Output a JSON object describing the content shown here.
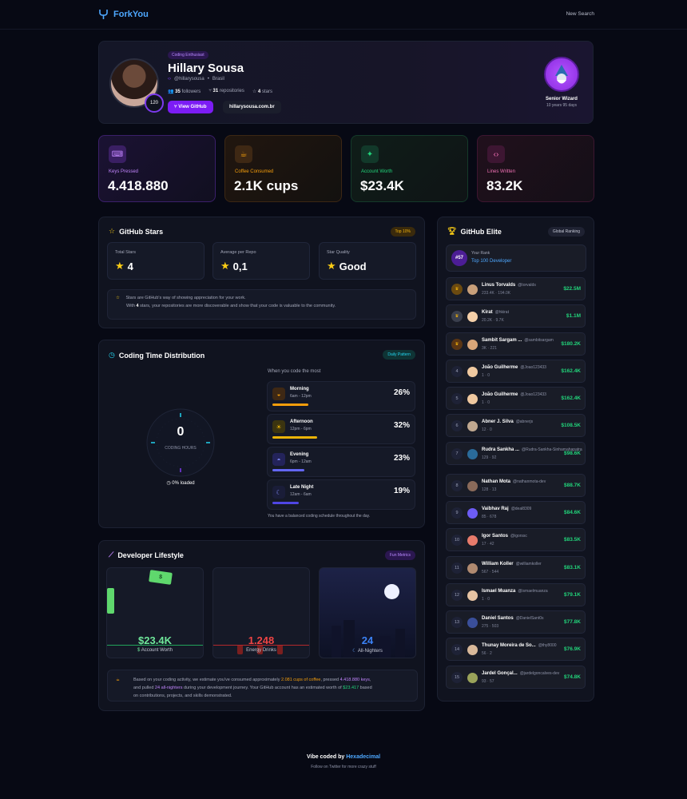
{
  "nav": {
    "brand": "ForkYou",
    "new_search": "New Search"
  },
  "profile": {
    "badge": "Coding Enthusiast",
    "name": "Hillary Sousa",
    "handle": "@hillarysousa",
    "location": "Brasil",
    "followers": "35",
    "followers_label": "followers",
    "repos": "31",
    "repos_label": "repositories",
    "stars": "4",
    "stars_label": "stars",
    "level": "120",
    "view_github": "View GitHub",
    "website": "hillarysousa.com.br",
    "rank_title": "Senior Wizard",
    "rank_sub": "10 years 95 days"
  },
  "stats": [
    {
      "label": "Keys Pressed",
      "value": "4.418.880",
      "color": "#c084fc"
    },
    {
      "label": "Coffee Consumed",
      "value": "2.1K cups",
      "color": "#f59e0b"
    },
    {
      "label": "Account Worth",
      "value": "$23.4K",
      "color": "#22d37a"
    },
    {
      "label": "Lines Written",
      "value": "83.2K",
      "color": "#f472b6"
    }
  ],
  "stars_section": {
    "title": "GitHub Stars",
    "badge": "Top 10%",
    "total_label": "Total Stars",
    "total": "4",
    "avg_label": "Average per Repo",
    "avg": "0,1",
    "quality_label": "Star Quality",
    "quality": "Good",
    "note_line1": "Stars are GitHub's way of showing appreciation for your work.",
    "note_line2_a": "With ",
    "note_line2_b": "4",
    "note_line2_c": " stars, your repositories are more discoverable and show that your code is valuable to the community."
  },
  "coding_time": {
    "title": "Coding Time Distribution",
    "badge": "Daily Pattern",
    "clock_value": "0",
    "clock_label": "CODING HOURS",
    "loaded": "0% loaded",
    "subtitle": "When you code the most",
    "slots": [
      {
        "name": "Morning",
        "range": "6am - 12pm",
        "pct": "26%",
        "fraction": 0.26,
        "color": "#f59e0b"
      },
      {
        "name": "Afternoon",
        "range": "12pm - 6pm",
        "pct": "32%",
        "fraction": 0.32,
        "color": "#eab308"
      },
      {
        "name": "Evening",
        "range": "6pm - 12am",
        "pct": "23%",
        "fraction": 0.23,
        "color": "#6366f1"
      },
      {
        "name": "Late Night",
        "range": "12am - 6am",
        "pct": "19%",
        "fraction": 0.19,
        "color": "#4f46e5"
      }
    ],
    "footer": "You have a balanced coding schedule throughout the day."
  },
  "lifestyle": {
    "title": "Developer Lifestyle",
    "badge": "Fun Metrics",
    "cards": [
      {
        "value": "$23.4K",
        "label": "Account Worth",
        "color": "#6ee79a"
      },
      {
        "value": "1.248",
        "label": "Energy Drinks",
        "color": "#ef4444"
      },
      {
        "value": "24",
        "label": "All-Nighters",
        "color": "#3b82f6"
      }
    ],
    "note_a": "Based on your coding activity, we estimate you've consumed approximately ",
    "note_coffee": "2.081 cups of coffee",
    "note_b": ", pressed ",
    "note_keys": "4.418.880 keys",
    "note_c": ",",
    "note_d": "and pulled ",
    "note_night": "24 all-nighters",
    "note_e": " during your development journey. Your GitHub account has an estimated worth of ",
    "note_worth": "$23.417",
    "note_f": " based",
    "note_g": "on contributions, projects, and skills demonstrated."
  },
  "elite": {
    "title": "GitHub Elite",
    "badge": "Global Ranking",
    "your_rank_label": "Your Rank",
    "your_rank": "#57",
    "your_rank_desc": "Top 100 Developer",
    "rows": [
      {
        "rank": "",
        "name": "Linus Torvalds",
        "handle": "@torvalds",
        "stats": "233.4K · 194.0K",
        "worth": "$22.5M"
      },
      {
        "rank": "",
        "name": "Kirat",
        "handle": "@hkirat",
        "stats": "20.2K · 9.7K",
        "worth": "$1.1M"
      },
      {
        "rank": "",
        "name": "Sambit Sargam ...",
        "handle": "@sambitsargam",
        "stats": "3K · 221",
        "worth": "$180.2K"
      },
      {
        "rank": "4",
        "name": "João Guilherme",
        "handle": "@Joao123433",
        "stats": "1 · 0",
        "worth": "$162.4K"
      },
      {
        "rank": "5",
        "name": "João Guilherme",
        "handle": "@Joao123433",
        "stats": "1 · 0",
        "worth": "$162.4K"
      },
      {
        "rank": "6",
        "name": "Abner J. Silva",
        "handle": "@abnerjs",
        "stats": "12 · 0",
        "worth": "$108.5K"
      },
      {
        "rank": "7",
        "name": "Rudra Sankha ...",
        "handle": "@Rudra-Sankha-Sinhamahapatra",
        "stats": "129 · 92",
        "worth": "$98.6K"
      },
      {
        "rank": "8",
        "name": "Nathan Mota",
        "handle": "@nathanmota-dev",
        "stats": "128 · 13",
        "worth": "$88.7K"
      },
      {
        "rank": "9",
        "name": "Vaibhav Raj",
        "handle": "@deal8309",
        "stats": "85 · 678",
        "worth": "$84.6K"
      },
      {
        "rank": "10",
        "name": "Igor Santos",
        "handle": "@igorssc",
        "stats": "17 · 42",
        "worth": "$83.5K"
      },
      {
        "rank": "11",
        "name": "William Koller",
        "handle": "@williamkoller",
        "stats": "567 · 544",
        "worth": "$83.1K"
      },
      {
        "rank": "12",
        "name": "Ismael Muanza",
        "handle": "@ismaelmuanza",
        "stats": "1 · 0",
        "worth": "$79.1K"
      },
      {
        "rank": "13",
        "name": "Daniel Santos",
        "handle": "@DanielSant0s",
        "stats": "275 · 503",
        "worth": "$77.8K"
      },
      {
        "rank": "14",
        "name": "Thunay Moreira de So...",
        "handle": "@thy8000",
        "stats": "56 · 2",
        "worth": "$76.9K"
      },
      {
        "rank": "15",
        "name": "Jardel Gonçal...",
        "handle": "@jardelgoncalves-dev",
        "stats": "93 · 57",
        "worth": "$74.8K"
      }
    ]
  },
  "footer": {
    "prefix": "Vibe coded by ",
    "author": "Hexadecimal",
    "sub": "Follow on Twitter for more crazy stuff"
  }
}
